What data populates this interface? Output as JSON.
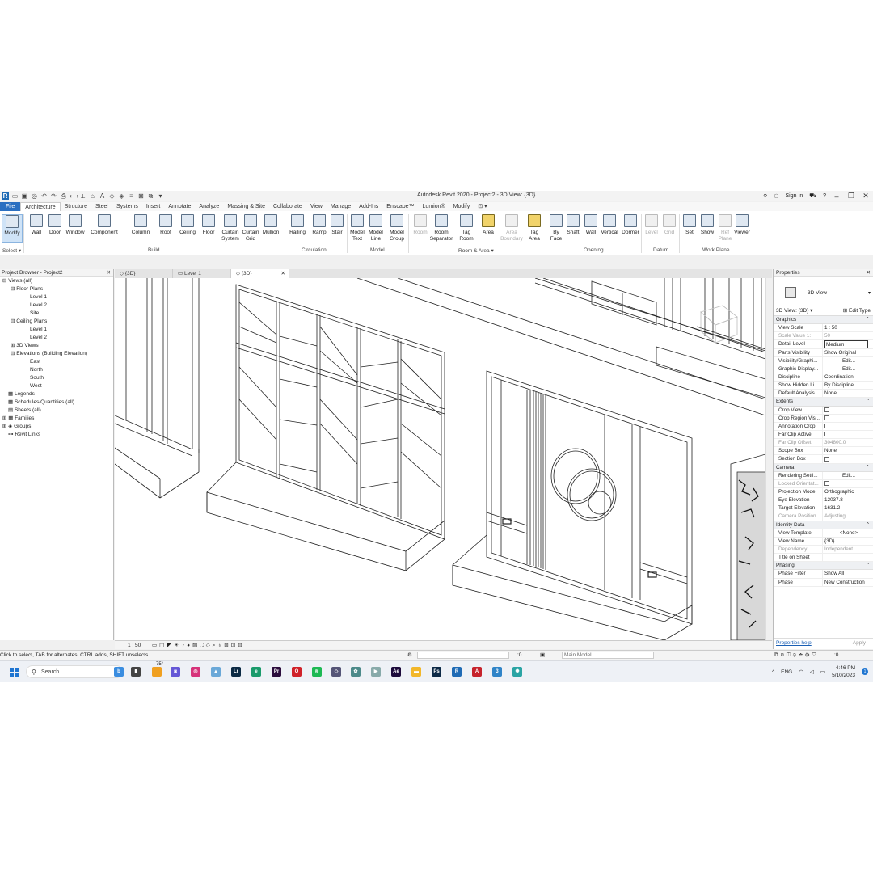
{
  "title_bar": {
    "title": "Autodesk Revit 2020 - Project2 - 3D View: {3D}",
    "sign_in": "Sign In",
    "qat_logo": "R",
    "text_tool": "A"
  },
  "ribbon_tabs": [
    "File",
    "Architecture",
    "Structure",
    "Steel",
    "Systems",
    "Insert",
    "Annotate",
    "Analyze",
    "Massing & Site",
    "Collaborate",
    "View",
    "Manage",
    "Add-Ins",
    "Enscape™",
    "Lumion®",
    "Modify"
  ],
  "ribbon": {
    "modify": "Modify",
    "select": "Select ▾",
    "build": [
      "Wall",
      "Door",
      "Window",
      "Component",
      "Column",
      "Roof",
      "Ceiling",
      "Floor",
      "Curtain\nSystem",
      "Curtain\nGrid",
      "Mullion"
    ],
    "circulation": [
      "Railing",
      "Ramp",
      "Stair"
    ],
    "model": [
      "Model\nText",
      "Model\nLine",
      "Model\nGroup"
    ],
    "room_area": [
      "Room",
      "Room\nSeparator",
      "Tag\nRoom",
      "Area",
      "Area\nBoundary",
      "Tag\nArea"
    ],
    "opening": [
      "By\nFace",
      "Shaft",
      "Wall",
      "Vertical",
      "Dormer"
    ],
    "datum": [
      "Level",
      "Grid"
    ],
    "work_plane": [
      "Set",
      "Show",
      "Ref\nPlane",
      "Viewer"
    ],
    "panels": {
      "build": "Build",
      "circulation": "Circulation",
      "model": "Model",
      "room_area": "Room & Area ▾",
      "opening": "Opening",
      "datum": "Datum",
      "work_plane": "Work Plane"
    }
  },
  "project_browser": {
    "title": "Project Browser - Project2",
    "views_all": "Views (all)",
    "floor_plans": "Floor Plans",
    "fp_items": [
      "Level 1",
      "Level 2",
      "Site"
    ],
    "ceiling_plans": "Ceiling Plans",
    "cp_items": [
      "Level 1",
      "Level 2"
    ],
    "views_3d": "3D Views",
    "elevations": "Elevations (Building Elevation)",
    "el_items": [
      "East",
      "North",
      "South",
      "West"
    ],
    "legends": "Legends",
    "schedules": "Schedules/Quantities (all)",
    "sheets": "Sheets (all)",
    "families": "Families",
    "groups": "Groups",
    "revit_links": "Revit Links"
  },
  "view_tabs": [
    "{3D}",
    "Level 1",
    "{3D}"
  ],
  "view_scale_label": "1 : 50",
  "properties": {
    "title": "Properties",
    "type_name": "3D View",
    "instance": "3D View: {3D}",
    "edit_type": "Edit Type",
    "groups": {
      "graphics": "Graphics",
      "extents": "Extents",
      "camera": "Camera",
      "identity": "Identity Data",
      "phasing": "Phasing"
    },
    "graphics": [
      {
        "k": "View Scale",
        "v": "1 : 50"
      },
      {
        "k": "Scale Value    1:",
        "v": "50",
        "dis": true
      },
      {
        "k": "Detail Level",
        "v": "Medium",
        "box": true
      },
      {
        "k": "Parts Visibility",
        "v": "Show Original"
      },
      {
        "k": "Visibility/Graphi...",
        "v": "Edit...",
        "btn": true
      },
      {
        "k": "Graphic Display...",
        "v": "Edit...",
        "btn": true
      },
      {
        "k": "Discipline",
        "v": "Coordination"
      },
      {
        "k": "Show Hidden Li...",
        "v": "By Discipline"
      },
      {
        "k": "Default Analysis...",
        "v": "None"
      }
    ],
    "extents": [
      {
        "k": "Crop View",
        "cb": true
      },
      {
        "k": "Crop Region Vis...",
        "cb": true
      },
      {
        "k": "Annotation Crop",
        "cb": true
      },
      {
        "k": "Far Clip Active",
        "cb": true
      },
      {
        "k": "Far Clip Offset",
        "v": "304800.0",
        "dis": true
      },
      {
        "k": "Scope Box",
        "v": "None"
      },
      {
        "k": "Section Box",
        "cb": true
      }
    ],
    "camera": [
      {
        "k": "Rendering Setti...",
        "v": "Edit...",
        "btn": true
      },
      {
        "k": "Locked Orientat...",
        "cb": true,
        "dis": true
      },
      {
        "k": "Projection Mode",
        "v": "Orthographic"
      },
      {
        "k": "Eye Elevation",
        "v": "12037.8"
      },
      {
        "k": "Target Elevation",
        "v": "1631.2"
      },
      {
        "k": "Camera Position",
        "v": "Adjusting",
        "dis": true
      }
    ],
    "identity": [
      {
        "k": "View Template",
        "v": "<None>",
        "btn": true
      },
      {
        "k": "View Name",
        "v": "{3D}"
      },
      {
        "k": "Dependency",
        "v": "Independent",
        "dis": true
      },
      {
        "k": "Title on Sheet",
        "v": ""
      }
    ],
    "phasing": [
      {
        "k": "Phase Filter",
        "v": "Show All"
      },
      {
        "k": "Phase",
        "v": "New Construction"
      }
    ],
    "help": "Properties help",
    "apply": "Apply"
  },
  "status": {
    "message": "Click to select, TAB for alternates, CTRL adds, SHIFT unselects.",
    "coord": ":0",
    "model": "Main Model",
    "filter": ":0"
  },
  "taskbar": {
    "search": "Search",
    "weather": "75°",
    "lang": "ENG",
    "time": "4:46 PM",
    "date": "5/10/2023",
    "badge": "1"
  }
}
